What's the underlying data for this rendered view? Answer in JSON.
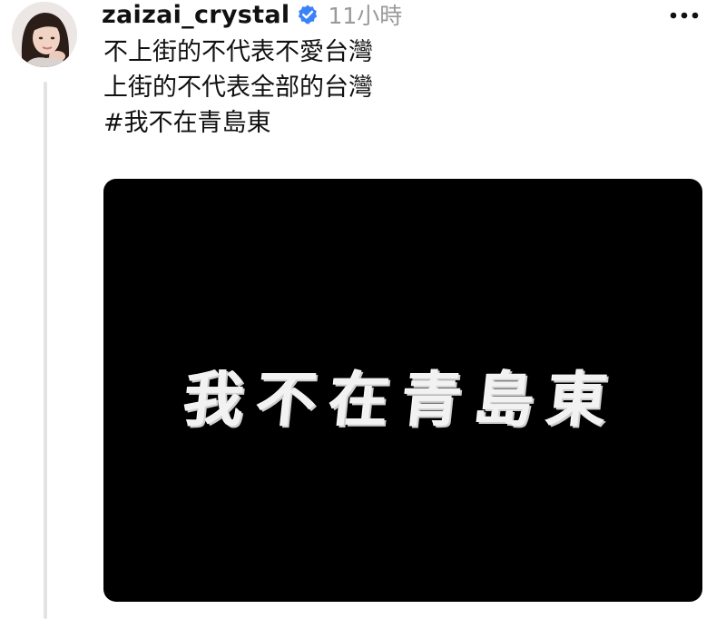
{
  "post": {
    "username": "zaizai_crystal",
    "timestamp": "11小時",
    "verified": true,
    "lines": [
      "不上街的不代表不愛台灣",
      "上街的不代表全部的台灣"
    ],
    "hashtag": "#我不在青島東",
    "media_text": "我不在青島東",
    "more_icon": "more-horizontal-icon",
    "verified_icon": "verified-badge-icon"
  },
  "colors": {
    "text": "#111111",
    "timestamp": "#9a9a9a",
    "verified": "#3b82f6",
    "thread_line": "#e3e3e3",
    "media_bg": "#000000",
    "media_text": "#f2f2f2"
  }
}
